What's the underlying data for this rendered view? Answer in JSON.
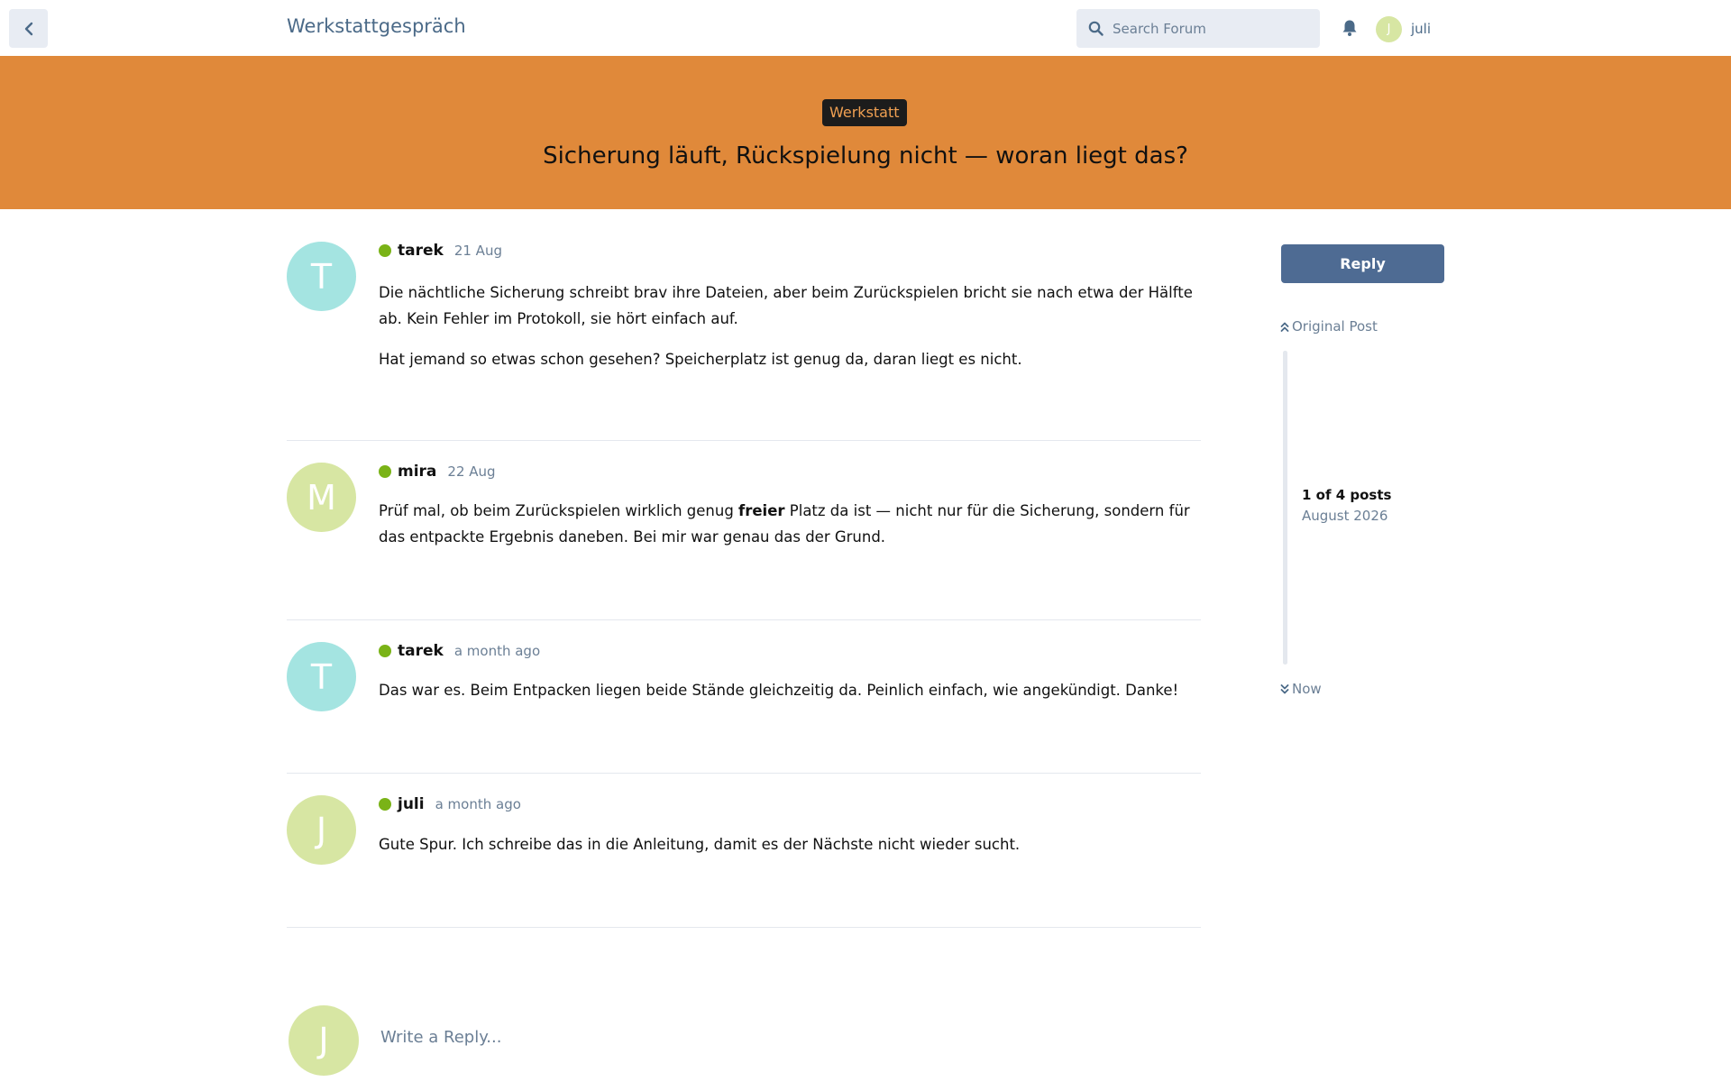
{
  "header": {
    "back_icon": "chevron-left-icon",
    "forum_title": "Werkstattgespräch",
    "search_placeholder": "Search Forum",
    "search_icon": "search-icon",
    "notifications_icon": "bell-icon",
    "user_initial": "J",
    "user_name": "juli"
  },
  "hero": {
    "color": "#e0893a",
    "tag": "Werkstatt",
    "title": "Sicherung läuft, Rückspielung nicht — woran liegt das?"
  },
  "posts": [
    {
      "initial": "T",
      "avatar_color": "#a4e4e1",
      "author": "tarek",
      "time": "21 Aug",
      "paragraphs": [
        "Die nächtliche Sicherung schreibt brav ihre Dateien, aber beim Zurückspielen bricht sie nach etwa der Hälfte ab. Kein Fehler im Protokoll, sie hört einfach auf.",
        "Hat jemand so etwas schon gesehen? Speicherplatz ist genug da, daran liegt es nicht."
      ]
    },
    {
      "initial": "M",
      "avatar_color": "#d7e6a3",
      "author": "mira",
      "time": "22 Aug",
      "paragraph_parts": {
        "before": "Prüf mal, ob beim Zurückspielen wirklich genug ",
        "bold": "freier",
        "after": " Platz da ist — nicht nur für die Sicherung, sondern für das entpackte Ergebnis daneben. Bei mir war genau das der Grund."
      }
    },
    {
      "initial": "T",
      "avatar_color": "#a4e4e1",
      "author": "tarek",
      "time": "a month ago",
      "paragraphs": [
        "Das war es. Beim Entpacken liegen beide Stände gleichzeitig da. Peinlich einfach, wie angekündigt. Danke!"
      ]
    },
    {
      "initial": "J",
      "avatar_color": "#d7e6a3",
      "author": "juli",
      "time": "a month ago",
      "paragraphs": [
        "Gute Spur. Ich schreibe das in die Anleitung, damit es der Nächste nicht wieder sucht."
      ]
    }
  ],
  "composer": {
    "initial": "J",
    "placeholder": "Write a Reply..."
  },
  "sidebar": {
    "reply_label": "Reply",
    "original_post_label": "Original Post",
    "post_count_label": "1 of 4 posts",
    "date_label": "August 2026",
    "now_label": "Now",
    "status_online_color": "#7ab317"
  }
}
